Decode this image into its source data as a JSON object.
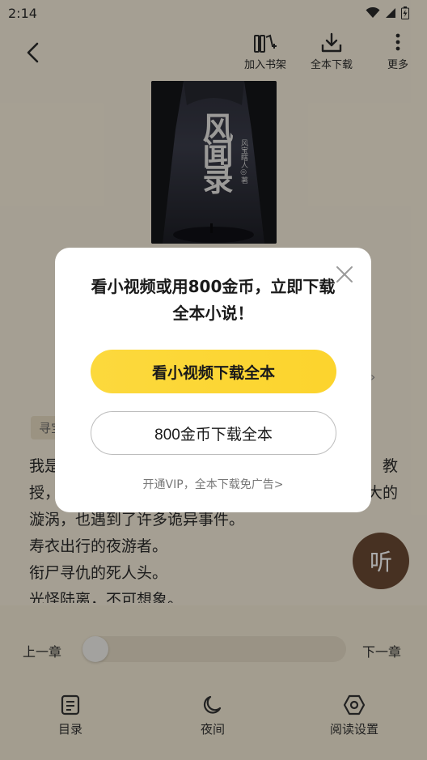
{
  "status_bar": {
    "time": "2:14"
  },
  "top_bar": {
    "add_to_shelf": "加入书架",
    "download_all": "全本下载",
    "more": "更多"
  },
  "cover": {
    "title_text": "风闻录",
    "author_text": "风宝瞎人◎著"
  },
  "chapter": {
    "tag": "寻宝",
    "lines": [
      {
        "left": "我是",
        "right": "教"
      },
      {
        "left": "授，",
        "right": "大的"
      },
      {
        "left": "漩涡，也遇到了许多诡异事件。",
        "right": ""
      },
      {
        "left": "寿衣出行的夜游者。",
        "right": ""
      },
      {
        "left": "衔尸寻仇的死人头。",
        "right": ""
      },
      {
        "left": "光怪陆离，不可想象。",
        "right": ""
      }
    ]
  },
  "listen_button": {
    "label": "听"
  },
  "bottom_panel": {
    "prev_chapter": "上一章",
    "next_chapter": "下一章",
    "progress": 0,
    "nav": {
      "toc": "目录",
      "night": "夜间",
      "settings": "阅读设置"
    }
  },
  "dialog": {
    "title": "看小视频或用800金币，立即下载全本小说！",
    "video_button": "看小视频下载全本",
    "coins_button": "800金币下载全本",
    "vip_link": "开通VIP，全本下载免广告>"
  },
  "colors": {
    "accent_yellow": "#fcd93d",
    "listen_brown": "#6b4a34",
    "page_bg": "#f7eedb"
  }
}
